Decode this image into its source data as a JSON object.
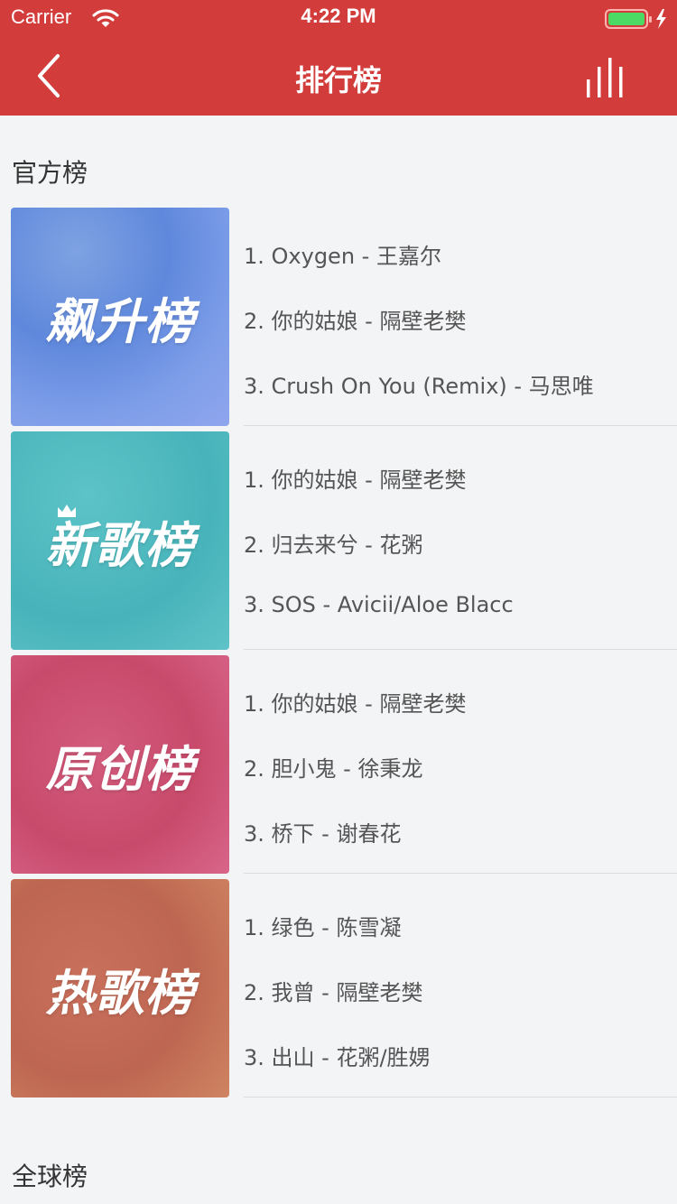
{
  "status_bar": {
    "carrier": "Carrier",
    "time": "4:22 PM"
  },
  "nav": {
    "title": "排行榜"
  },
  "sections": {
    "official": "官方榜",
    "global": "全球榜"
  },
  "charts": [
    {
      "cover_text": "飙升榜",
      "cover_color": "#6f93e0",
      "songs": [
        "1. Oxygen - 王嘉尔",
        "2. 你的姑娘 - 隔壁老樊",
        "3. Crush On You (Remix) - 马思唯"
      ]
    },
    {
      "cover_text": "新歌榜",
      "cover_color": "#50bcc1",
      "songs": [
        "1. 你的姑娘 - 隔壁老樊",
        "2. 归去来兮 - 花粥",
        "3. SOS - Avicii/Aloe Blacc"
      ]
    },
    {
      "cover_text": "原创榜",
      "cover_color": "#cd5476",
      "songs": [
        "1. 你的姑娘 - 隔壁老樊",
        "2. 胆小鬼 - 徐秉龙",
        "3. 桥下 - 谢春花"
      ]
    },
    {
      "cover_text": "热歌榜",
      "cover_color": "#c46c56",
      "songs": [
        "1. 绿色 - 陈雪凝",
        "2. 我曾 - 隔壁老樊",
        "3. 出山 - 花粥/胜娚"
      ]
    }
  ],
  "colors": {
    "header": "#d23c3a",
    "background": "#f3f4f6"
  },
  "icons": {
    "back": "chevron-left-icon",
    "playing": "equalizer-bars-icon",
    "wifi": "wifi-icon",
    "battery": "battery-icon"
  }
}
